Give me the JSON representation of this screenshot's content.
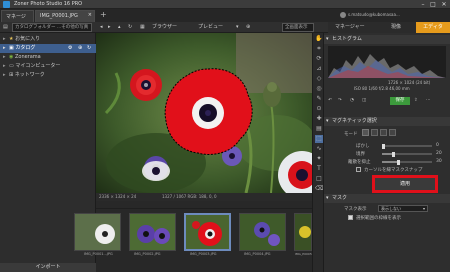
{
  "app": {
    "title": "Zoner Photo Studio 16 PRO"
  },
  "window_controls": {
    "minimize": "–",
    "maximize": "□",
    "close": "✕"
  },
  "tabs": [
    {
      "label": "マネージャー"
    },
    {
      "label": "IMG_P0001.JPG",
      "close": "×"
    }
  ],
  "tab_add": "+",
  "account": {
    "email": "s.matsudo@kubomasaa..."
  },
  "modes": [
    {
      "label": "マネージャー"
    },
    {
      "label": "現像"
    },
    {
      "label": "エディター"
    }
  ],
  "toolbar": {
    "path": "カタログフォルダー ...その他の写真",
    "browser": "ブラウザー",
    "preview": "プレビュー",
    "zoom": "全画面表示"
  },
  "navigator": {
    "items": [
      {
        "label": "お気に入り",
        "arrow": "▸"
      },
      {
        "label": "カタログ",
        "arrow": "▸"
      },
      {
        "label": "Zonerama",
        "arrow": "▸"
      },
      {
        "label": "マイコンピューター",
        "arrow": "▸"
      },
      {
        "label": "ネットワーク",
        "arrow": "▸"
      }
    ],
    "import_label": "インポート"
  },
  "preview_info": "2336 × 1324 × 24",
  "preview_info2": "1327 / 1067   RGB: 188, 0, 0",
  "filmstrip": [
    {
      "label": "IMG_P0001...JPG"
    },
    {
      "label": "IMG_P0002.JPG"
    },
    {
      "label": "IMG_P0003.JPG"
    },
    {
      "label": "IMG_P0004.JPG"
    },
    {
      "label": "IMG_P0005...JPG"
    }
  ],
  "histogram": {
    "title": "ヒストグラム",
    "info": "1726 × 1024 (24 bit)",
    "info2": "ISO 80   1/60   f/2.8   46,00 mm"
  },
  "edit_tools": {
    "save_label": "保存"
  },
  "magnetic": {
    "title": "マグネティック選択",
    "mode_label": "モード",
    "rows": [
      {
        "label": "ぼかし",
        "value": "0"
      },
      {
        "label": "境界",
        "value": "20"
      },
      {
        "label": "離散を抑止",
        "value": "30"
      }
    ],
    "checkbox_label": "カーソルを縁マスクスナップ",
    "apply_label": "適用"
  },
  "mask": {
    "title": "マスク",
    "display_label": "マスク表示",
    "display_value": "表示しない",
    "invert_label": "選択範囲の枠線を表示"
  },
  "colors": {
    "accent": "#e0101a",
    "selection": "#3e5f8f"
  }
}
